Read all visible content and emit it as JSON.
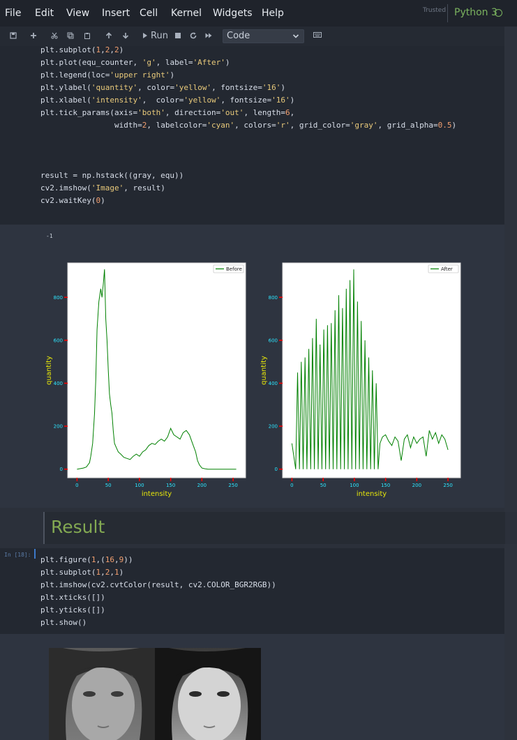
{
  "menubar": {
    "items": [
      "File",
      "Edit",
      "View",
      "Insert",
      "Cell",
      "Kernel",
      "Widgets",
      "Help"
    ],
    "trusted": "Trusted",
    "kernel": "Python 3"
  },
  "toolbar": {
    "run_label": "Run",
    "cell_type": "Code",
    "icons": [
      "save-icon",
      "add-cell-icon",
      "cut-icon",
      "copy-icon",
      "paste-icon",
      "move-up-icon",
      "move-down-icon",
      "run-icon",
      "stop-icon",
      "restart-icon",
      "fast-forward-icon",
      "keyboard-icon"
    ]
  },
  "cell1": {
    "lines": [
      "plt.subplot(1,2,2)",
      "plt.plot(equ_counter, 'g', label='After')",
      "plt.legend(loc='upper right')",
      "plt.ylabel('quantity', color='yellow', fontsize='16')",
      "plt.xlabel('intensity',  color='yellow', fontsize='16')",
      "plt.tick_params(axis='both', direction='out', length=6,",
      "                width=2, labelcolor='cyan', colors='r', grid_color='gray', grid_alpha=0.5)",
      "",
      "",
      "",
      "result = np.hstack((gray, equ))",
      "cv2.imshow('Image', result)",
      "cv2.waitKey(0)"
    ]
  },
  "output1": {
    "text": "-1"
  },
  "markdown": {
    "heading": "Result"
  },
  "cell2": {
    "prompt": "In [18]:",
    "lines": [
      "plt.figure(1,(16,9))",
      "plt.subplot(1,2,1)",
      "plt.imshow(cv2.cvtColor(result, cv2.COLOR_BGR2RGB))",
      "plt.xticks([])",
      "plt.yticks([])",
      "plt.show()"
    ]
  },
  "chart_data": [
    {
      "type": "line",
      "xlabel": "intensity",
      "ylabel": "quantity",
      "xlim": [
        -15,
        270
      ],
      "ylim": [
        -40,
        960
      ],
      "xticks": [
        0,
        50,
        100,
        150,
        200,
        250
      ],
      "yticks": [
        0,
        200,
        400,
        600,
        800
      ],
      "legend": "upper right",
      "color": "#008000",
      "series": [
        {
          "name": "Before",
          "x": [
            0,
            10,
            15,
            20,
            22,
            25,
            28,
            30,
            32,
            35,
            38,
            40,
            42,
            44,
            46,
            48,
            50,
            52,
            54,
            56,
            58,
            60,
            63,
            66,
            70,
            75,
            80,
            85,
            90,
            95,
            100,
            105,
            110,
            115,
            120,
            125,
            130,
            135,
            140,
            145,
            150,
            155,
            160,
            165,
            170,
            175,
            180,
            185,
            190,
            193,
            196,
            200,
            205,
            210,
            220,
            230,
            240,
            255
          ],
          "values": [
            0,
            5,
            10,
            30,
            60,
            120,
            260,
            420,
            650,
            780,
            840,
            800,
            860,
            930,
            700,
            600,
            460,
            350,
            300,
            260,
            180,
            120,
            100,
            80,
            70,
            55,
            50,
            45,
            60,
            70,
            60,
            80,
            90,
            110,
            120,
            115,
            130,
            140,
            130,
            150,
            190,
            160,
            150,
            140,
            170,
            180,
            160,
            120,
            80,
            40,
            20,
            5,
            2,
            0,
            0,
            0,
            0,
            0
          ]
        }
      ]
    },
    {
      "type": "line",
      "xlabel": "intensity",
      "ylabel": "quantity",
      "xlim": [
        -15,
        270
      ],
      "ylim": [
        -40,
        960
      ],
      "xticks": [
        0,
        50,
        100,
        150,
        200,
        250
      ],
      "yticks": [
        0,
        200,
        400,
        600,
        800
      ],
      "legend": "upper right",
      "color": "#008000",
      "series": [
        {
          "name": "After",
          "x": [
            0,
            3,
            6,
            9,
            12,
            15,
            18,
            21,
            24,
            27,
            30,
            33,
            36,
            39,
            42,
            45,
            48,
            51,
            54,
            57,
            60,
            63,
            66,
            69,
            72,
            75,
            78,
            81,
            84,
            87,
            90,
            93,
            96,
            99,
            102,
            105,
            108,
            111,
            114,
            117,
            120,
            123,
            126,
            129,
            132,
            135,
            138,
            141,
            145,
            150,
            155,
            160,
            165,
            170,
            175,
            180,
            185,
            190,
            195,
            200,
            205,
            210,
            215,
            220,
            225,
            230,
            235,
            240,
            245,
            250
          ],
          "values": [
            120,
            60,
            0,
            450,
            0,
            500,
            0,
            520,
            0,
            560,
            0,
            610,
            0,
            700,
            0,
            580,
            0,
            650,
            0,
            670,
            0,
            680,
            0,
            740,
            0,
            810,
            0,
            750,
            0,
            840,
            0,
            880,
            0,
            930,
            0,
            780,
            0,
            690,
            0,
            600,
            0,
            520,
            0,
            460,
            0,
            400,
            0,
            120,
            150,
            160,
            130,
            110,
            150,
            130,
            40,
            140,
            160,
            100,
            150,
            120,
            140,
            150,
            60,
            180,
            140,
            170,
            120,
            160,
            140,
            90
          ]
        }
      ]
    }
  ]
}
